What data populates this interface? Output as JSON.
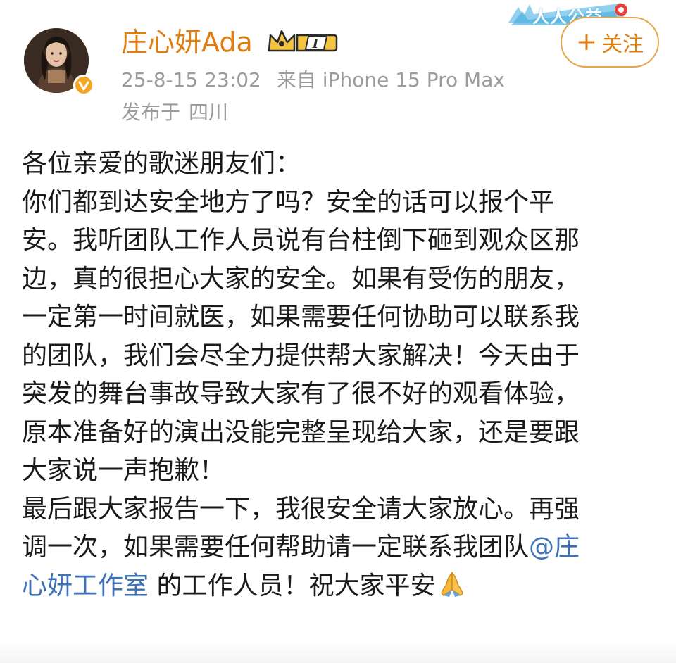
{
  "post": {
    "author": {
      "name": "庄心妍Ada",
      "vip_level": "I",
      "verified": true
    },
    "follow_button": {
      "plus": "+",
      "label": "关注"
    },
    "campaign_tag": "人人公益",
    "meta": {
      "date_time": "25-8-15 23:02",
      "source": "来自 iPhone 15 Pro Max"
    },
    "location": {
      "prefix": "发布于",
      "place": "四川"
    },
    "body": {
      "lines": [
        "各位亲爱的歌迷朋友们：",
        "你们都到达安全地方了吗？安全的话可以报个平",
        "安。我听团队工作人员说有台柱倒下砸到观众区那",
        "边，真的很担心大家的安全。如果有受伤的朋友，",
        "一定第一时间就医，如果需要任何协助可以联系我",
        "的团队，我们会尽全力提供帮大家解决！今天由于",
        "突发的舞台事故导致大家有了很不好的观看体验，",
        "原本准备好的演出没能完整呈现给大家，还是要跟",
        "大家说一声抱歉！",
        "最后跟大家报告一下，我很安全请大家放心。再强"
      ],
      "line11_text": "调一次，如果需要任何帮助请一定联系我团队",
      "mention_part1": "@庄",
      "mention_part2": "心妍工作室",
      "line12_rest": " 的工作人员！祝大家平安"
    },
    "icons": {
      "avatar": "avatar-photo",
      "verified": "verified-v-icon",
      "vip": "crown-vip-icon",
      "emoji": "praying-hands-icon"
    },
    "colors": {
      "author_name": "#e07d0f",
      "mention": "#3d72b8",
      "meta_text": "#9b9b9b",
      "follow_border": "#e8a54b",
      "verified_badge": "#f5a623"
    }
  }
}
